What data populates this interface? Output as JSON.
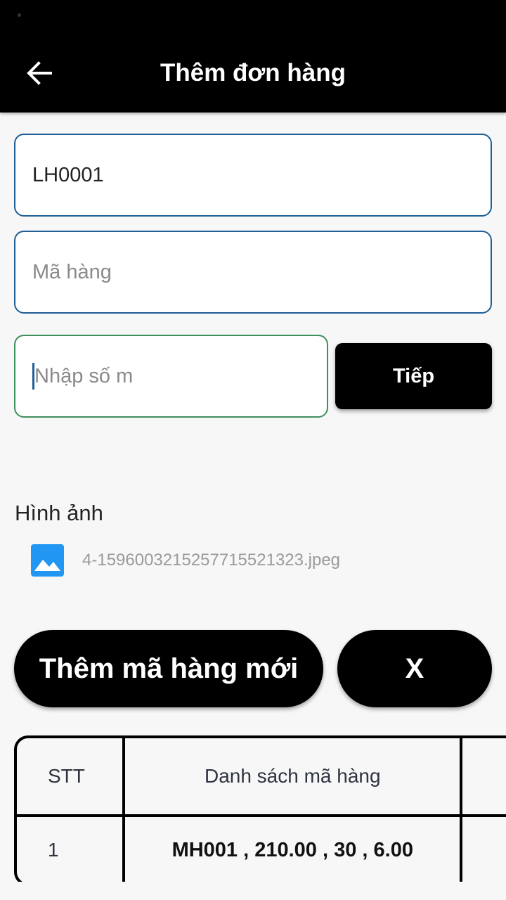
{
  "app_bar": {
    "title": "Thêm đơn hàng",
    "back_icon": "arrow-left-icon"
  },
  "form": {
    "order_code_value": "LH0001",
    "product_code_placeholder": "Mã hàng",
    "meters_placeholder": "Nhập số m",
    "next_button_label": "Tiếp"
  },
  "image_section": {
    "label": "Hình ảnh",
    "file_icon": "image-icon",
    "file_name": "4-1596003215257715521323.jpeg"
  },
  "actions": {
    "add_new_label": "Thêm mã hàng mới",
    "close_label": "X"
  },
  "table": {
    "headers": [
      "STT",
      "Danh sách mã hàng",
      ""
    ],
    "rows": [
      {
        "stt": "1",
        "items": "MH001 , 210.00 , 30 , 6.00"
      }
    ]
  },
  "colors": {
    "app_bar_bg": "#000000",
    "field_border": "#1f5e96",
    "field_focus_border": "#3f8f5c",
    "image_icon": "#2196f3"
  }
}
